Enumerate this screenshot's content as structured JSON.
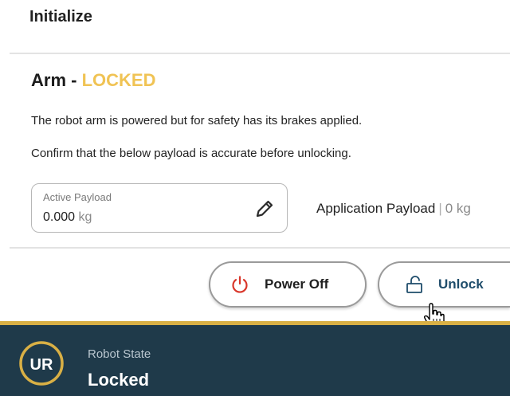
{
  "dialog": {
    "title": "Initialize"
  },
  "arm": {
    "name": "Arm",
    "separator": " - ",
    "status": "LOCKED",
    "description_1": "The robot arm is powered but for safety has its brakes applied.",
    "description_2": "Confirm that the below payload is accurate before unlocking."
  },
  "payload": {
    "label": "Active Payload",
    "value": "0.000",
    "unit": "kg",
    "edit_icon": "pencil-icon"
  },
  "application_payload": {
    "label": "Application Payload",
    "separator": "|",
    "value": "0 kg"
  },
  "buttons": {
    "power_off": {
      "label": "Power Off",
      "icon": "power-icon"
    },
    "unlock": {
      "label": "Unlock",
      "icon": "unlock-icon"
    }
  },
  "footer": {
    "label": "Robot State",
    "value": "Locked",
    "logo_text": "UR"
  },
  "colors": {
    "status_locked": "#f0c354",
    "power_icon": "#d9372b",
    "footer_bg": "#1f3a4a",
    "footer_accent": "#d9b045",
    "unlock_text": "#1f4d6b"
  }
}
